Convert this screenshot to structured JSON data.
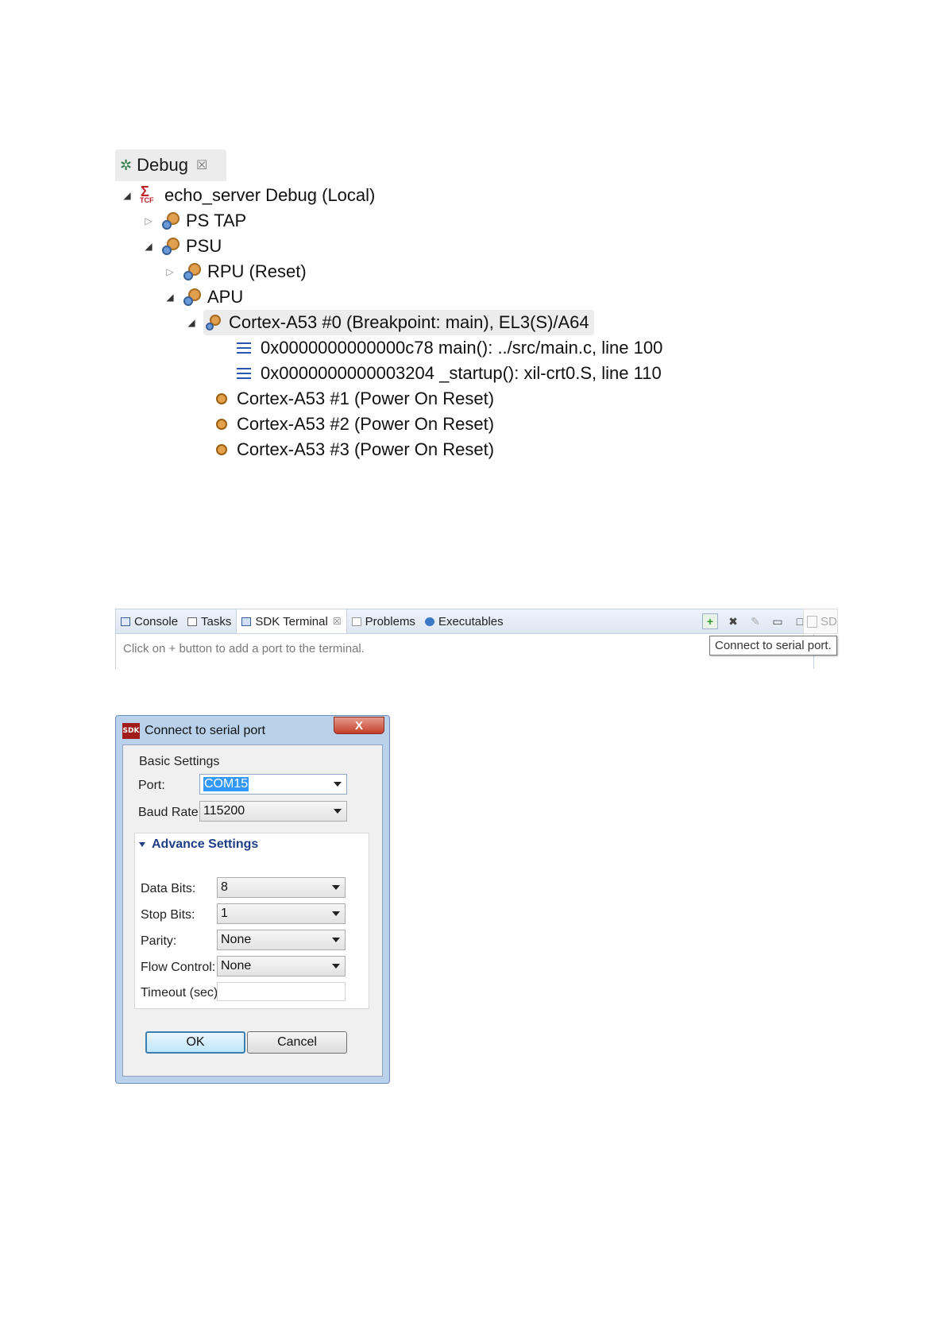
{
  "debug_view": {
    "tab_title": "Debug",
    "tree": [
      {
        "label": "echo_server Debug (Local)",
        "icon": "tcf-launch-icon",
        "expanded": true,
        "level": 0
      },
      {
        "label": "PS TAP",
        "icon": "gear-group-icon",
        "expanded": false,
        "level": 1
      },
      {
        "label": "PSU",
        "icon": "gear-group-icon",
        "expanded": true,
        "level": 1
      },
      {
        "label": "RPU (Reset)",
        "icon": "gear-group-icon",
        "expanded": false,
        "level": 2
      },
      {
        "label": "APU",
        "icon": "gear-group-icon",
        "expanded": true,
        "level": 2
      },
      {
        "label": "Cortex-A53 #0 (Breakpoint: main), EL3(S)/A64",
        "icon": "core-suspended-icon",
        "expanded": true,
        "level": 3,
        "selected": true
      },
      {
        "label": "0x0000000000000c78 main(): ../src/main.c, line 100",
        "icon": "stack-frame-icon",
        "level": 4
      },
      {
        "label": "0x0000000000003204 _startup(): xil-crt0.S, line 110",
        "icon": "stack-frame-icon",
        "level": 4
      },
      {
        "label": "Cortex-A53 #1 (Power On Reset)",
        "icon": "core-icon",
        "level": 3
      },
      {
        "label": "Cortex-A53 #2 (Power On Reset)",
        "icon": "core-icon",
        "level": 3
      },
      {
        "label": "Cortex-A53 #3 (Power On Reset)",
        "icon": "core-icon",
        "level": 3
      }
    ]
  },
  "terminal_view": {
    "tabs": [
      {
        "label": "Console",
        "icon": "console-icon"
      },
      {
        "label": "Tasks",
        "icon": "tasks-icon"
      },
      {
        "label": "SDK Terminal",
        "icon": "terminal-icon",
        "active": true
      },
      {
        "label": "Problems",
        "icon": "problems-icon"
      },
      {
        "label": "Executables",
        "icon": "executables-icon"
      }
    ],
    "side_tab": "SD",
    "hint": "Click on + button to add a port to the terminal.",
    "tooltip": "Connect to serial port."
  },
  "dialog": {
    "title": "Connect to serial port",
    "close_label": "X",
    "logo_text": "SDK",
    "basic_settings_label": "Basic Settings",
    "port_label": "Port:",
    "port_value": "COM15",
    "baud_label": "Baud Rate:",
    "baud_value": "115200",
    "advanced_label": "Advance Settings",
    "data_bits_label": "Data Bits:",
    "data_bits_value": "8",
    "stop_bits_label": "Stop Bits:",
    "stop_bits_value": "1",
    "parity_label": "Parity:",
    "parity_value": "None",
    "flow_label": "Flow Control:",
    "flow_value": "None",
    "timeout_label": "Timeout (sec):",
    "timeout_value": "",
    "ok_label": "OK",
    "cancel_label": "Cancel"
  }
}
